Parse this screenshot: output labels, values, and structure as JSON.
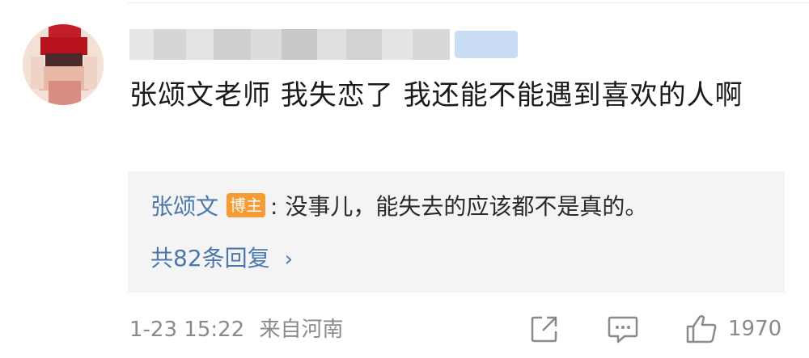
{
  "comment": {
    "text": "张颂文老师  我失恋了  我还能不能遇到喜欢的人啊"
  },
  "reply": {
    "author": "张颂文",
    "badge": "博主",
    "separator": ":",
    "text": "没事儿，能失去的应该都不是真的。",
    "more_label": "共82条回复",
    "more_chevron": "›"
  },
  "meta": {
    "time": "1-23 15:22",
    "location": "来自河南"
  },
  "actions": {
    "like_count": "1970",
    "share_icon": "share-icon",
    "comment_icon": "comment-icon",
    "like_icon": "thumbs-up-icon"
  },
  "colors": {
    "link": "#4a77b0",
    "badge": "#f79b35",
    "reply_bg": "#f4f4f4",
    "meta": "#8a8a8a"
  }
}
